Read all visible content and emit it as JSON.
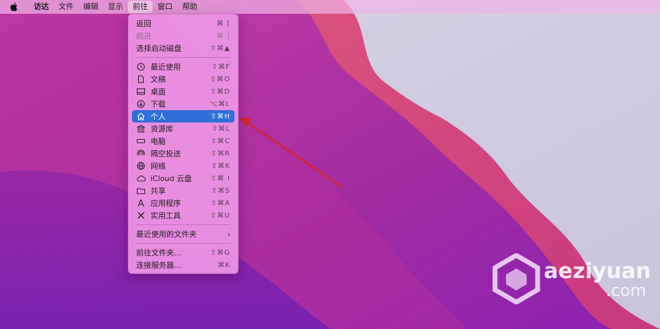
{
  "menubar": {
    "apple_icon": "apple-logo-icon",
    "items": [
      {
        "label": "访达",
        "bold": true
      },
      {
        "label": "文件"
      },
      {
        "label": "编辑"
      },
      {
        "label": "显示"
      },
      {
        "label": "前往",
        "active": true
      },
      {
        "label": "窗口"
      },
      {
        "label": "帮助"
      }
    ]
  },
  "go_menu": {
    "section1": [
      {
        "label": "返回",
        "shortcut": "⌘ [",
        "disabled": false
      },
      {
        "label": "前进",
        "shortcut": "⌘ ]",
        "disabled": true
      },
      {
        "label": "选择启动磁盘",
        "shortcut": "⇧⌘▲",
        "disabled": false
      }
    ],
    "section2": [
      {
        "label": "最近使用",
        "shortcut": "⇧⌘F",
        "icon": "clock-icon"
      },
      {
        "label": "文稿",
        "shortcut": "⇧⌘O",
        "icon": "document-icon"
      },
      {
        "label": "桌面",
        "shortcut": "⇧⌘D",
        "icon": "desktop-icon"
      },
      {
        "label": "下载",
        "shortcut": "⌥⌘L",
        "icon": "download-icon"
      },
      {
        "label": "个人",
        "shortcut": "⇧⌘H",
        "icon": "home-icon",
        "selected": true
      },
      {
        "label": "资源库",
        "shortcut": "⇧⌘L",
        "icon": "library-icon"
      },
      {
        "label": "电脑",
        "shortcut": "⇧⌘C",
        "icon": "computer-icon"
      },
      {
        "label": "隔空投送",
        "shortcut": "⇧⌘R",
        "icon": "airdrop-icon"
      },
      {
        "label": "网络",
        "shortcut": "⇧⌘K",
        "icon": "network-icon"
      },
      {
        "label": "iCloud 云盘",
        "shortcut": "⇧⌘ I",
        "icon": "cloud-icon"
      },
      {
        "label": "共享",
        "shortcut": "⇧⌘S",
        "icon": "shared-folder-icon"
      },
      {
        "label": "应用程序",
        "shortcut": "⇧⌘A",
        "icon": "applications-icon"
      },
      {
        "label": "实用工具",
        "shortcut": "⇧⌘U",
        "icon": "utilities-icon"
      }
    ],
    "section3": [
      {
        "label": "最近使用的文件夹",
        "submenu": "›"
      }
    ],
    "section4": [
      {
        "label": "前往文件夹...",
        "shortcut": "⇧⌘G"
      },
      {
        "label": "连接服务器...",
        "shortcut": "⌘K"
      }
    ]
  },
  "watermark": {
    "text": "aeziyuan",
    "sub": ".com"
  },
  "colors": {
    "selection": "#2f6fd8",
    "arrow": "#d8242a"
  }
}
